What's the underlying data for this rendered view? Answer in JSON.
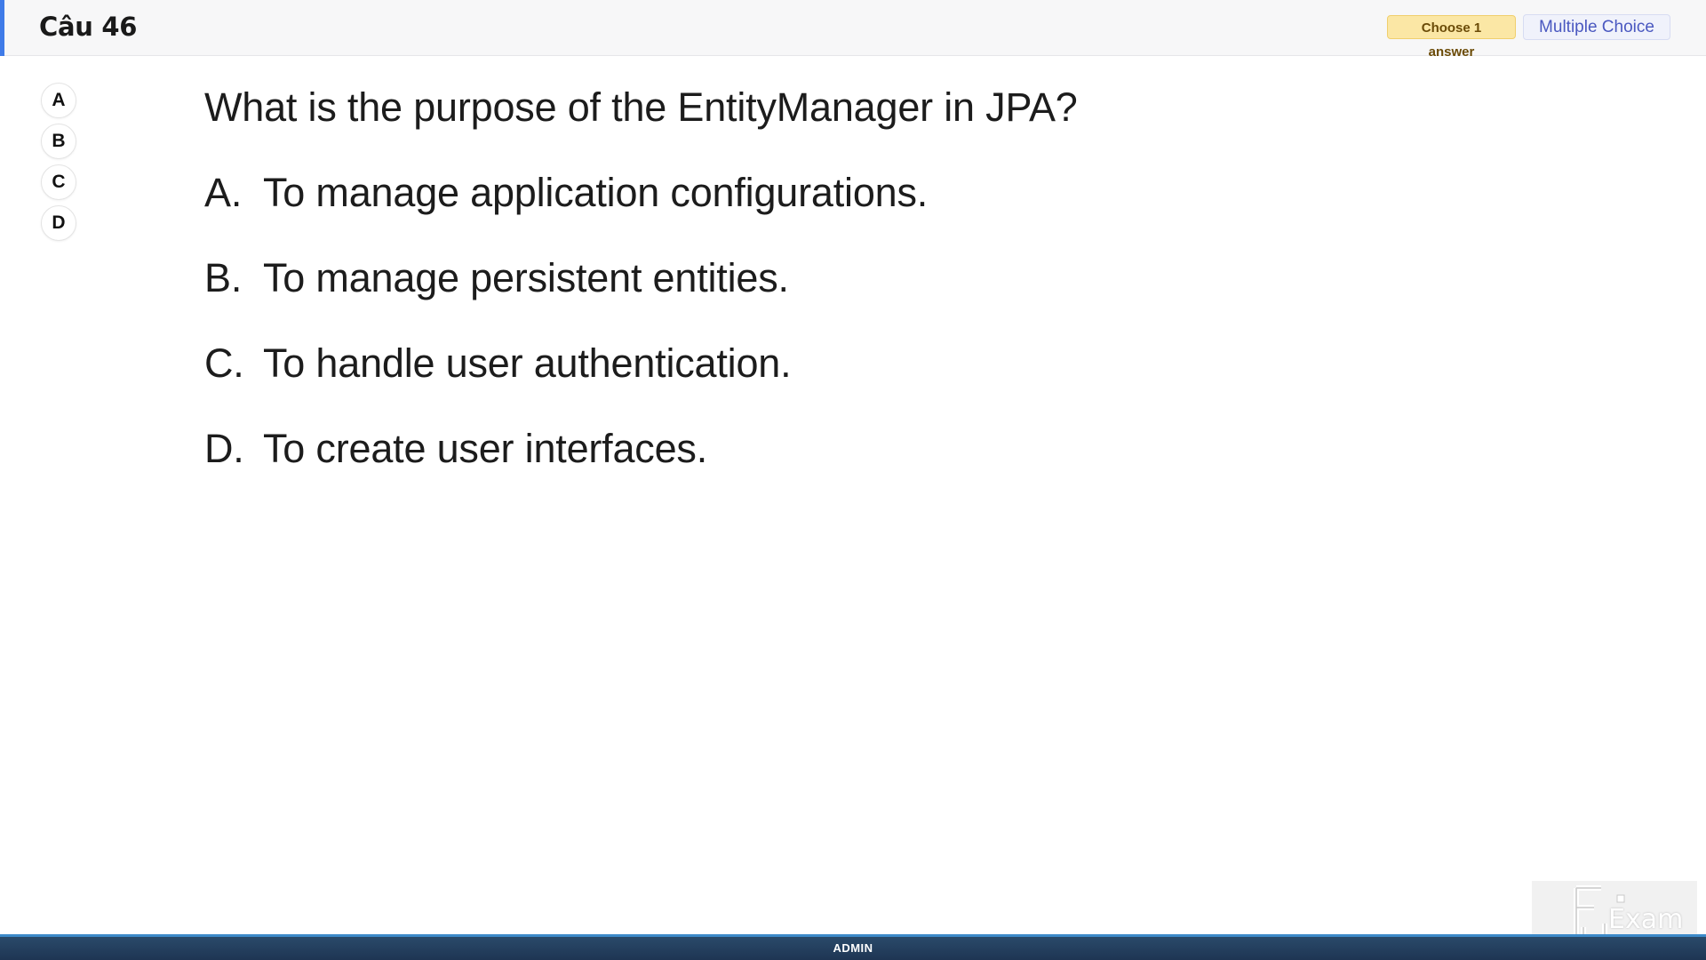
{
  "header": {
    "title": "Câu 46",
    "choose_badge": "Choose 1 answer",
    "type_badge": "Multiple Choice"
  },
  "answers": [
    "A",
    "B",
    "C",
    "D"
  ],
  "question": {
    "text": "What is the purpose of the EntityManager in JPA?",
    "options": [
      {
        "letter": "A.",
        "text": "To manage application configurations."
      },
      {
        "letter": "B.",
        "text": "To manage persistent entities."
      },
      {
        "letter": "C.",
        "text": "To handle user authentication."
      },
      {
        "letter": "D.",
        "text": "To create user interfaces."
      }
    ]
  },
  "footer": {
    "label": "ADMIN"
  },
  "logo": {
    "text": "Exam",
    "icon": "fu-exam-logo-icon"
  },
  "colors": {
    "accent": "#3f7be8",
    "badge_yellow": "#fbe7a5",
    "badge_blue_text": "#4a58c0",
    "footer": "#1e3553"
  }
}
